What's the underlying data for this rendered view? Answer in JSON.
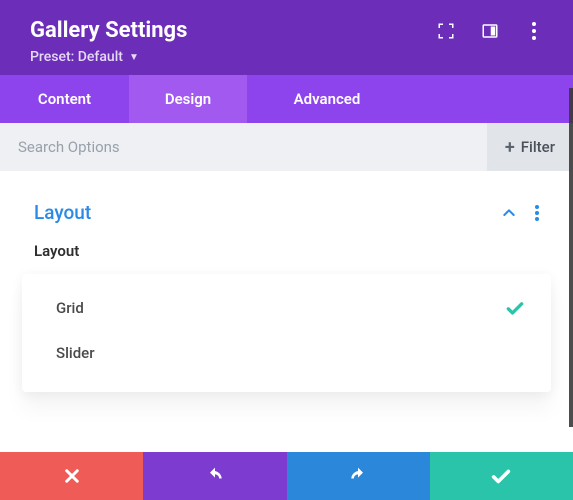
{
  "header": {
    "title": "Gallery Settings",
    "preset_label": "Preset: Default"
  },
  "tabs": {
    "content": "Content",
    "design": "Design",
    "advanced": "Advanced"
  },
  "search": {
    "placeholder": "Search Options",
    "filter_label": "Filter"
  },
  "section": {
    "title": "Layout",
    "field_label": "Layout",
    "options": {
      "grid": "Grid",
      "slider": "Slider"
    }
  }
}
